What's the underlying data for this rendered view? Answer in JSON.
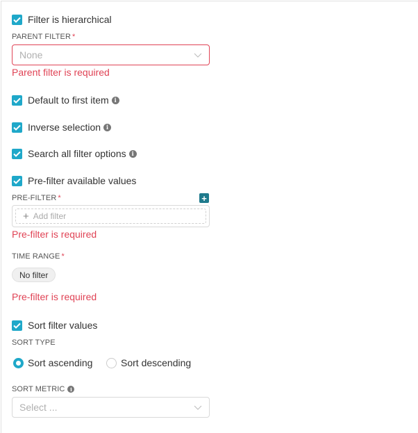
{
  "colors": {
    "accent": "#1fa8c9",
    "error": "#e04355",
    "plus_button": "#1f7a8c"
  },
  "options": {
    "hierarchical": {
      "label": "Filter is hierarchical",
      "checked": true
    },
    "default_first": {
      "label": "Default to first item",
      "checked": true,
      "info_icon": "info-icon"
    },
    "inverse": {
      "label": "Inverse selection",
      "checked": true,
      "info_icon": "info-icon"
    },
    "search_all": {
      "label": "Search all filter options",
      "checked": true,
      "info_icon": "info-icon"
    },
    "prefilter": {
      "label": "Pre-filter available values",
      "checked": true
    },
    "sort_values": {
      "label": "Sort filter values",
      "checked": true
    }
  },
  "parent_filter": {
    "label": "PARENT FILTER",
    "required_mark": "*",
    "value": "None",
    "error": "Parent filter is required"
  },
  "pre_filter": {
    "label": "PRE-FILTER",
    "required_mark": "*",
    "add_button": "+",
    "add_filter_label": "Add filter",
    "add_filter_icon": "+",
    "error": "Pre-filter is required"
  },
  "time_range": {
    "label": "TIME RANGE",
    "required_mark": "*",
    "value": "No filter",
    "error": "Pre-filter is required"
  },
  "sort_type": {
    "label": "SORT TYPE",
    "options": [
      {
        "label": "Sort ascending",
        "selected": true
      },
      {
        "label": "Sort descending",
        "selected": false
      }
    ]
  },
  "sort_metric": {
    "label": "SORT METRIC",
    "placeholder": "Select ..."
  }
}
